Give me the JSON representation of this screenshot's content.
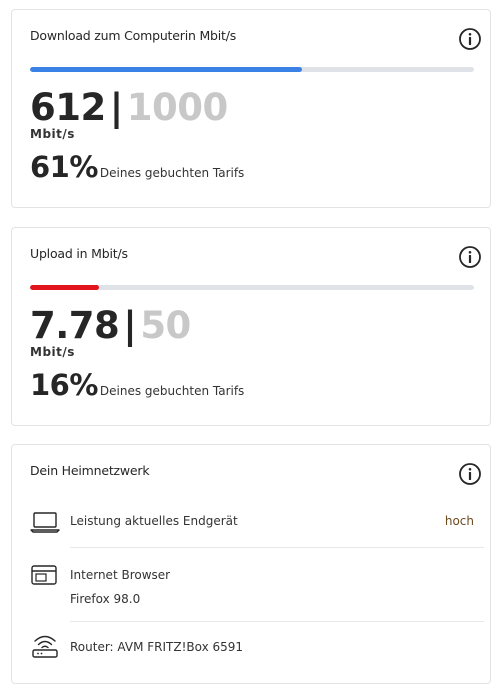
{
  "download": {
    "title_strong": "Download zum Computer",
    "title_rest": "in Mbit/s",
    "measured": "612",
    "separator": "|",
    "booked": "1000",
    "unit": "Mbit/s",
    "percent": "61%",
    "percent_label": "Deines gebuchten Tarifs",
    "progress_fraction": 0.612,
    "bar_color": "#3b82e6"
  },
  "upload": {
    "title_strong": "Upload",
    "title_rest": " in Mbit/s",
    "measured": "7.78",
    "separator": "|",
    "booked": "50",
    "unit": "Mbit/s",
    "percent": "16%",
    "percent_label": "Deines gebuchten Tarifs",
    "progress_fraction": 0.156,
    "bar_color": "#e2141e"
  },
  "home": {
    "title": "Dein Heimnetzwerk",
    "items": [
      {
        "icon": "laptop-icon",
        "label": "Leistung aktuelles Endgerät",
        "value": "hoch"
      },
      {
        "icon": "browser-icon",
        "label": "Internet Browser",
        "sub": "Firefox 98.0"
      },
      {
        "icon": "wifi-router-icon",
        "label": "Router: AVM FRITZ!Box 6591"
      }
    ]
  }
}
